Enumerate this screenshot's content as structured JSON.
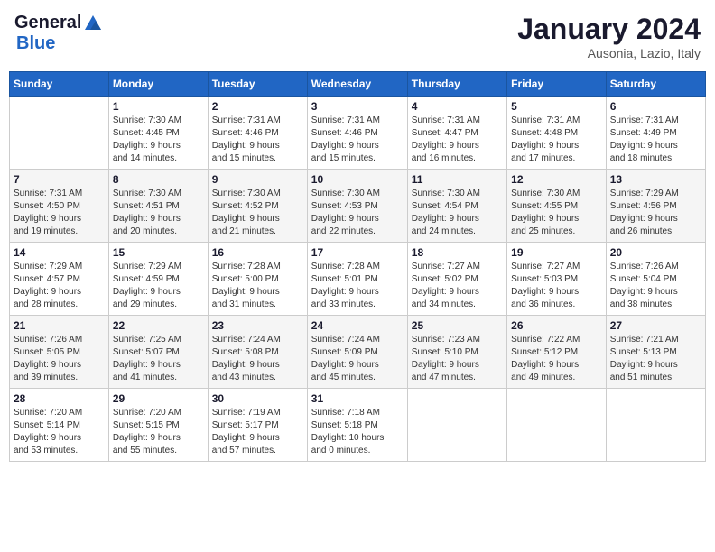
{
  "header": {
    "logo": {
      "general": "General",
      "blue": "Blue"
    },
    "title": "January 2024",
    "location": "Ausonia, Lazio, Italy"
  },
  "weekdays": [
    "Sunday",
    "Monday",
    "Tuesday",
    "Wednesday",
    "Thursday",
    "Friday",
    "Saturday"
  ],
  "weeks": [
    [
      {
        "day": "",
        "info": ""
      },
      {
        "day": "1",
        "info": "Sunrise: 7:30 AM\nSunset: 4:45 PM\nDaylight: 9 hours\nand 14 minutes."
      },
      {
        "day": "2",
        "info": "Sunrise: 7:31 AM\nSunset: 4:46 PM\nDaylight: 9 hours\nand 15 minutes."
      },
      {
        "day": "3",
        "info": "Sunrise: 7:31 AM\nSunset: 4:46 PM\nDaylight: 9 hours\nand 15 minutes."
      },
      {
        "day": "4",
        "info": "Sunrise: 7:31 AM\nSunset: 4:47 PM\nDaylight: 9 hours\nand 16 minutes."
      },
      {
        "day": "5",
        "info": "Sunrise: 7:31 AM\nSunset: 4:48 PM\nDaylight: 9 hours\nand 17 minutes."
      },
      {
        "day": "6",
        "info": "Sunrise: 7:31 AM\nSunset: 4:49 PM\nDaylight: 9 hours\nand 18 minutes."
      }
    ],
    [
      {
        "day": "7",
        "info": "Sunrise: 7:31 AM\nSunset: 4:50 PM\nDaylight: 9 hours\nand 19 minutes."
      },
      {
        "day": "8",
        "info": "Sunrise: 7:30 AM\nSunset: 4:51 PM\nDaylight: 9 hours\nand 20 minutes."
      },
      {
        "day": "9",
        "info": "Sunrise: 7:30 AM\nSunset: 4:52 PM\nDaylight: 9 hours\nand 21 minutes."
      },
      {
        "day": "10",
        "info": "Sunrise: 7:30 AM\nSunset: 4:53 PM\nDaylight: 9 hours\nand 22 minutes."
      },
      {
        "day": "11",
        "info": "Sunrise: 7:30 AM\nSunset: 4:54 PM\nDaylight: 9 hours\nand 24 minutes."
      },
      {
        "day": "12",
        "info": "Sunrise: 7:30 AM\nSunset: 4:55 PM\nDaylight: 9 hours\nand 25 minutes."
      },
      {
        "day": "13",
        "info": "Sunrise: 7:29 AM\nSunset: 4:56 PM\nDaylight: 9 hours\nand 26 minutes."
      }
    ],
    [
      {
        "day": "14",
        "info": "Sunrise: 7:29 AM\nSunset: 4:57 PM\nDaylight: 9 hours\nand 28 minutes."
      },
      {
        "day": "15",
        "info": "Sunrise: 7:29 AM\nSunset: 4:59 PM\nDaylight: 9 hours\nand 29 minutes."
      },
      {
        "day": "16",
        "info": "Sunrise: 7:28 AM\nSunset: 5:00 PM\nDaylight: 9 hours\nand 31 minutes."
      },
      {
        "day": "17",
        "info": "Sunrise: 7:28 AM\nSunset: 5:01 PM\nDaylight: 9 hours\nand 33 minutes."
      },
      {
        "day": "18",
        "info": "Sunrise: 7:27 AM\nSunset: 5:02 PM\nDaylight: 9 hours\nand 34 minutes."
      },
      {
        "day": "19",
        "info": "Sunrise: 7:27 AM\nSunset: 5:03 PM\nDaylight: 9 hours\nand 36 minutes."
      },
      {
        "day": "20",
        "info": "Sunrise: 7:26 AM\nSunset: 5:04 PM\nDaylight: 9 hours\nand 38 minutes."
      }
    ],
    [
      {
        "day": "21",
        "info": "Sunrise: 7:26 AM\nSunset: 5:05 PM\nDaylight: 9 hours\nand 39 minutes."
      },
      {
        "day": "22",
        "info": "Sunrise: 7:25 AM\nSunset: 5:07 PM\nDaylight: 9 hours\nand 41 minutes."
      },
      {
        "day": "23",
        "info": "Sunrise: 7:24 AM\nSunset: 5:08 PM\nDaylight: 9 hours\nand 43 minutes."
      },
      {
        "day": "24",
        "info": "Sunrise: 7:24 AM\nSunset: 5:09 PM\nDaylight: 9 hours\nand 45 minutes."
      },
      {
        "day": "25",
        "info": "Sunrise: 7:23 AM\nSunset: 5:10 PM\nDaylight: 9 hours\nand 47 minutes."
      },
      {
        "day": "26",
        "info": "Sunrise: 7:22 AM\nSunset: 5:12 PM\nDaylight: 9 hours\nand 49 minutes."
      },
      {
        "day": "27",
        "info": "Sunrise: 7:21 AM\nSunset: 5:13 PM\nDaylight: 9 hours\nand 51 minutes."
      }
    ],
    [
      {
        "day": "28",
        "info": "Sunrise: 7:20 AM\nSunset: 5:14 PM\nDaylight: 9 hours\nand 53 minutes."
      },
      {
        "day": "29",
        "info": "Sunrise: 7:20 AM\nSunset: 5:15 PM\nDaylight: 9 hours\nand 55 minutes."
      },
      {
        "day": "30",
        "info": "Sunrise: 7:19 AM\nSunset: 5:17 PM\nDaylight: 9 hours\nand 57 minutes."
      },
      {
        "day": "31",
        "info": "Sunrise: 7:18 AM\nSunset: 5:18 PM\nDaylight: 10 hours\nand 0 minutes."
      },
      {
        "day": "",
        "info": ""
      },
      {
        "day": "",
        "info": ""
      },
      {
        "day": "",
        "info": ""
      }
    ]
  ]
}
